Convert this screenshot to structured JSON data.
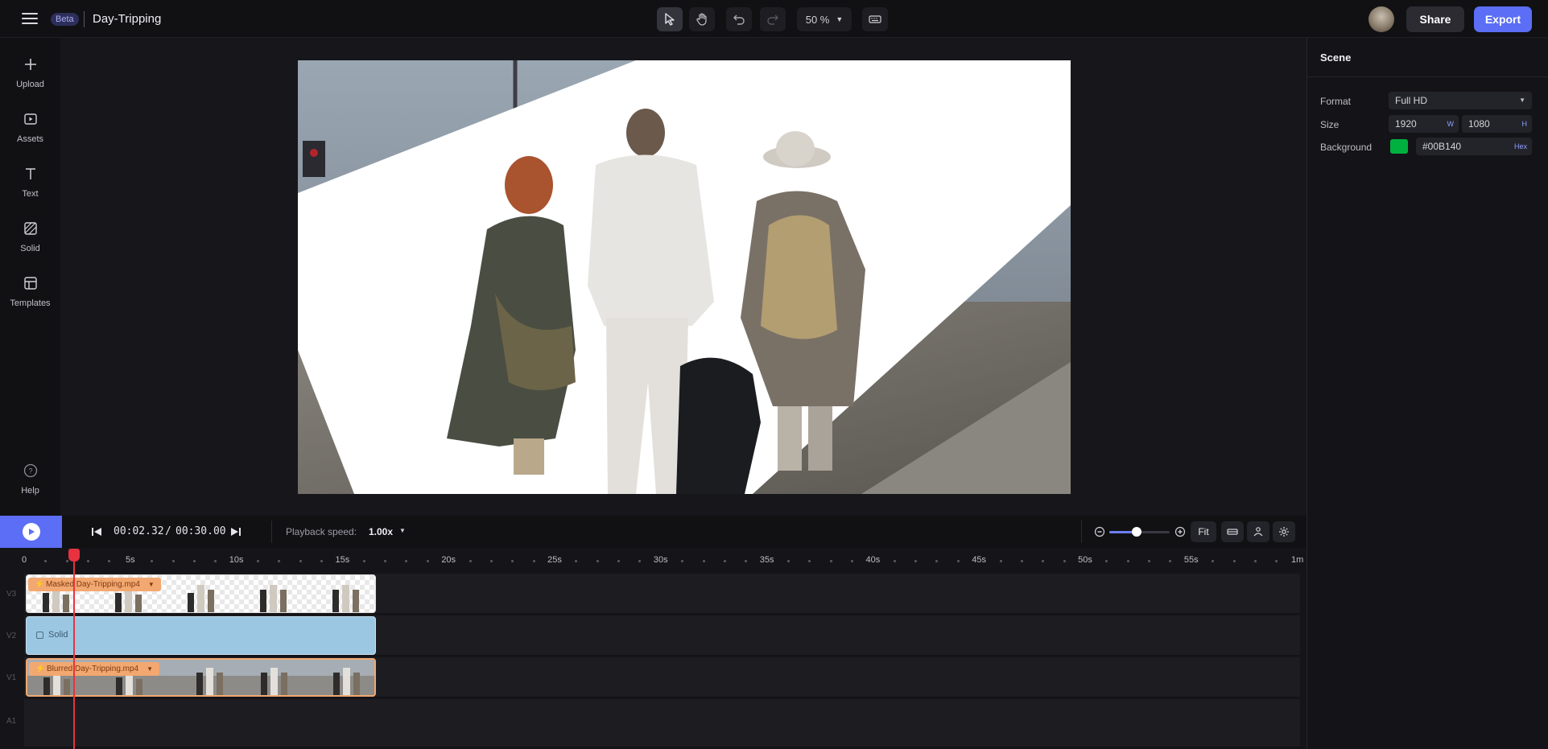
{
  "header": {
    "beta_badge": "Beta",
    "project_title": "Day-Tripping",
    "zoom_label": "50 %",
    "share_label": "Share",
    "export_label": "Export",
    "accent_color": "#5B6EF5"
  },
  "sidebar": {
    "items": [
      {
        "label": "Upload",
        "icon": "plus-icon"
      },
      {
        "label": "Assets",
        "icon": "media-folder-icon"
      },
      {
        "label": "Text",
        "icon": "text-icon"
      },
      {
        "label": "Solid",
        "icon": "solid-pattern-icon"
      },
      {
        "label": "Templates",
        "icon": "templates-icon"
      }
    ],
    "help_label": "Help"
  },
  "scene_panel": {
    "title": "Scene",
    "format_label": "Format",
    "format_value": "Full HD",
    "size_label": "Size",
    "width_value": "1920",
    "width_suffix": "W",
    "height_value": "1080",
    "height_suffix": "H",
    "background_label": "Background",
    "background_value": "#00B140",
    "background_suffix": "Hex",
    "background_color": "#00B140"
  },
  "transport": {
    "current_time": "00:02.32",
    "separator": "/",
    "total_time": "00:30.00",
    "speed_label": "Playback speed:",
    "speed_value": "1.00x",
    "fit_label": "Fit",
    "timeline_zoom_fraction": 0.45
  },
  "timeline": {
    "ruler_labels": [
      "0",
      "5s",
      "10s",
      "15s",
      "20s",
      "25s",
      "30s",
      "35s",
      "40s",
      "45s",
      "50s",
      "55s",
      "1m"
    ],
    "tracks": [
      {
        "name": "V3",
        "clip_label": "Masked Day-Tripping.mp4"
      },
      {
        "name": "V2",
        "clip_label": "Solid"
      },
      {
        "name": "V1",
        "clip_label": "Blurred Day-Tripping.mp4"
      },
      {
        "name": "A1",
        "clip_label": ""
      }
    ]
  }
}
